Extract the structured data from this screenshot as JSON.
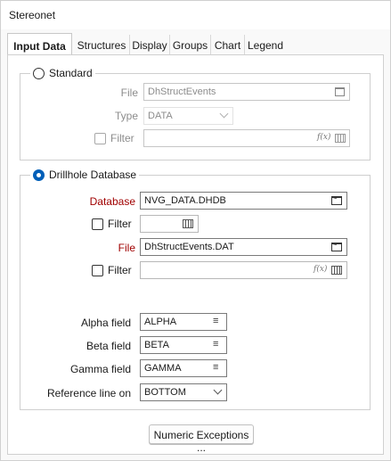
{
  "window": {
    "title": "Stereonet"
  },
  "tabs": [
    {
      "label": "Input Data",
      "active": true
    },
    {
      "label": "Structures",
      "active": false
    },
    {
      "label": "Display",
      "active": false
    },
    {
      "label": "Groups",
      "active": false
    },
    {
      "label": "Chart",
      "active": false
    },
    {
      "label": "Legend",
      "active": false
    }
  ],
  "standard": {
    "radio_label": "Standard",
    "selected": false,
    "file_label": "File",
    "file_value": "DhStructEvents",
    "type_label": "Type",
    "type_value": "DATA",
    "filter_label": "Filter",
    "filter_value": ""
  },
  "drillhole": {
    "radio_label": "Drillhole Database",
    "selected": true,
    "database_label": "Database",
    "database_value": "NVG_DATA.DHDB",
    "filter1_label": "Filter",
    "filter1_value": "",
    "file_label": "File",
    "file_value": "DhStructEvents.DAT",
    "filter2_label": "Filter",
    "filter2_value": "",
    "alpha_label": "Alpha field",
    "alpha_value": "ALPHA",
    "beta_label": "Beta field",
    "beta_value": "BETA",
    "gamma_label": "Gamma field",
    "gamma_value": "GAMMA",
    "refline_label": "Reference line on",
    "refline_value": "BOTTOM"
  },
  "buttons": {
    "numeric_exceptions": "Numeric Exceptions ..."
  },
  "colors": {
    "accent": "#005fb8",
    "required_label": "#a00000",
    "disabled_text": "#8c8c8c"
  },
  "icons": [
    "calendar-icon",
    "browse-icon",
    "function-icon",
    "grid-icon",
    "list-icon",
    "chevron-down-icon"
  ]
}
